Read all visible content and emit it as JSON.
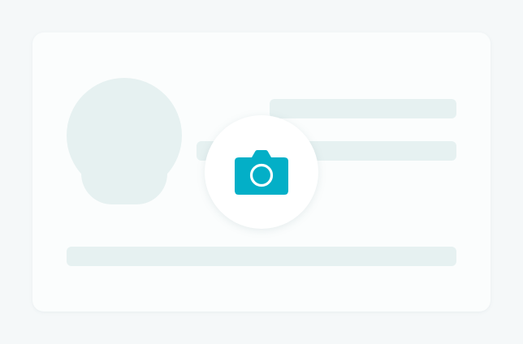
{
  "colors": {
    "page_background": "#f5f8f9",
    "card_background": "#fbfdfd",
    "placeholder": "#e6f1f1",
    "badge_background": "#ffffff",
    "accent": "#03afc7"
  },
  "card": {
    "avatar": {
      "icon": "avatar-placeholder-icon"
    },
    "text_placeholders": 3
  },
  "upload_button": {
    "icon": "camera-icon"
  }
}
